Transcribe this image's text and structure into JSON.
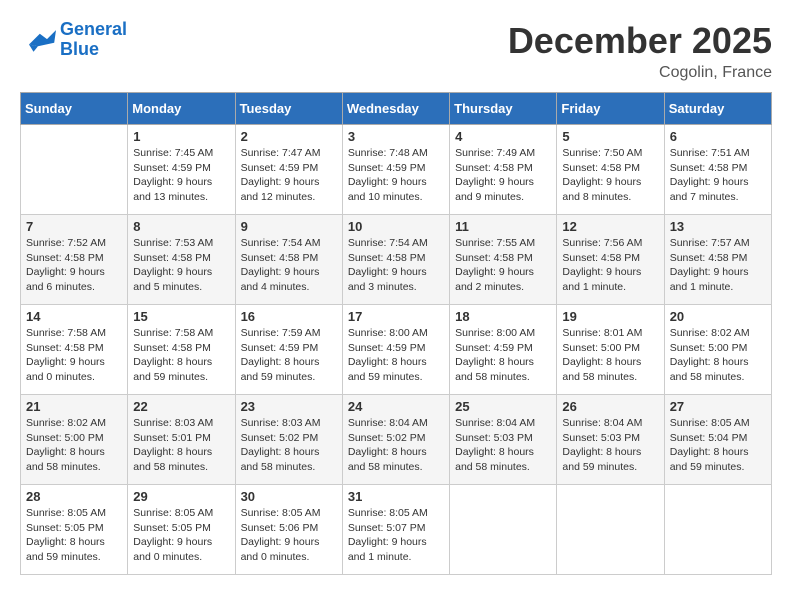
{
  "logo": {
    "line1": "General",
    "line2": "Blue"
  },
  "title": "December 2025",
  "location": "Cogolin, France",
  "weekdays": [
    "Sunday",
    "Monday",
    "Tuesday",
    "Wednesday",
    "Thursday",
    "Friday",
    "Saturday"
  ],
  "weeks": [
    [
      {
        "day": "",
        "info": ""
      },
      {
        "day": "1",
        "info": "Sunrise: 7:45 AM\nSunset: 4:59 PM\nDaylight: 9 hours\nand 13 minutes."
      },
      {
        "day": "2",
        "info": "Sunrise: 7:47 AM\nSunset: 4:59 PM\nDaylight: 9 hours\nand 12 minutes."
      },
      {
        "day": "3",
        "info": "Sunrise: 7:48 AM\nSunset: 4:59 PM\nDaylight: 9 hours\nand 10 minutes."
      },
      {
        "day": "4",
        "info": "Sunrise: 7:49 AM\nSunset: 4:58 PM\nDaylight: 9 hours\nand 9 minutes."
      },
      {
        "day": "5",
        "info": "Sunrise: 7:50 AM\nSunset: 4:58 PM\nDaylight: 9 hours\nand 8 minutes."
      },
      {
        "day": "6",
        "info": "Sunrise: 7:51 AM\nSunset: 4:58 PM\nDaylight: 9 hours\nand 7 minutes."
      }
    ],
    [
      {
        "day": "7",
        "info": "Sunrise: 7:52 AM\nSunset: 4:58 PM\nDaylight: 9 hours\nand 6 minutes."
      },
      {
        "day": "8",
        "info": "Sunrise: 7:53 AM\nSunset: 4:58 PM\nDaylight: 9 hours\nand 5 minutes."
      },
      {
        "day": "9",
        "info": "Sunrise: 7:54 AM\nSunset: 4:58 PM\nDaylight: 9 hours\nand 4 minutes."
      },
      {
        "day": "10",
        "info": "Sunrise: 7:54 AM\nSunset: 4:58 PM\nDaylight: 9 hours\nand 3 minutes."
      },
      {
        "day": "11",
        "info": "Sunrise: 7:55 AM\nSunset: 4:58 PM\nDaylight: 9 hours\nand 2 minutes."
      },
      {
        "day": "12",
        "info": "Sunrise: 7:56 AM\nSunset: 4:58 PM\nDaylight: 9 hours\nand 1 minute."
      },
      {
        "day": "13",
        "info": "Sunrise: 7:57 AM\nSunset: 4:58 PM\nDaylight: 9 hours\nand 1 minute."
      }
    ],
    [
      {
        "day": "14",
        "info": "Sunrise: 7:58 AM\nSunset: 4:58 PM\nDaylight: 9 hours\nand 0 minutes."
      },
      {
        "day": "15",
        "info": "Sunrise: 7:58 AM\nSunset: 4:58 PM\nDaylight: 8 hours\nand 59 minutes."
      },
      {
        "day": "16",
        "info": "Sunrise: 7:59 AM\nSunset: 4:59 PM\nDaylight: 8 hours\nand 59 minutes."
      },
      {
        "day": "17",
        "info": "Sunrise: 8:00 AM\nSunset: 4:59 PM\nDaylight: 8 hours\nand 59 minutes."
      },
      {
        "day": "18",
        "info": "Sunrise: 8:00 AM\nSunset: 4:59 PM\nDaylight: 8 hours\nand 58 minutes."
      },
      {
        "day": "19",
        "info": "Sunrise: 8:01 AM\nSunset: 5:00 PM\nDaylight: 8 hours\nand 58 minutes."
      },
      {
        "day": "20",
        "info": "Sunrise: 8:02 AM\nSunset: 5:00 PM\nDaylight: 8 hours\nand 58 minutes."
      }
    ],
    [
      {
        "day": "21",
        "info": "Sunrise: 8:02 AM\nSunset: 5:00 PM\nDaylight: 8 hours\nand 58 minutes."
      },
      {
        "day": "22",
        "info": "Sunrise: 8:03 AM\nSunset: 5:01 PM\nDaylight: 8 hours\nand 58 minutes."
      },
      {
        "day": "23",
        "info": "Sunrise: 8:03 AM\nSunset: 5:02 PM\nDaylight: 8 hours\nand 58 minutes."
      },
      {
        "day": "24",
        "info": "Sunrise: 8:04 AM\nSunset: 5:02 PM\nDaylight: 8 hours\nand 58 minutes."
      },
      {
        "day": "25",
        "info": "Sunrise: 8:04 AM\nSunset: 5:03 PM\nDaylight: 8 hours\nand 58 minutes."
      },
      {
        "day": "26",
        "info": "Sunrise: 8:04 AM\nSunset: 5:03 PM\nDaylight: 8 hours\nand 59 minutes."
      },
      {
        "day": "27",
        "info": "Sunrise: 8:05 AM\nSunset: 5:04 PM\nDaylight: 8 hours\nand 59 minutes."
      }
    ],
    [
      {
        "day": "28",
        "info": "Sunrise: 8:05 AM\nSunset: 5:05 PM\nDaylight: 8 hours\nand 59 minutes."
      },
      {
        "day": "29",
        "info": "Sunrise: 8:05 AM\nSunset: 5:05 PM\nDaylight: 9 hours\nand 0 minutes."
      },
      {
        "day": "30",
        "info": "Sunrise: 8:05 AM\nSunset: 5:06 PM\nDaylight: 9 hours\nand 0 minutes."
      },
      {
        "day": "31",
        "info": "Sunrise: 8:05 AM\nSunset: 5:07 PM\nDaylight: 9 hours\nand 1 minute."
      },
      {
        "day": "",
        "info": ""
      },
      {
        "day": "",
        "info": ""
      },
      {
        "day": "",
        "info": ""
      }
    ]
  ]
}
